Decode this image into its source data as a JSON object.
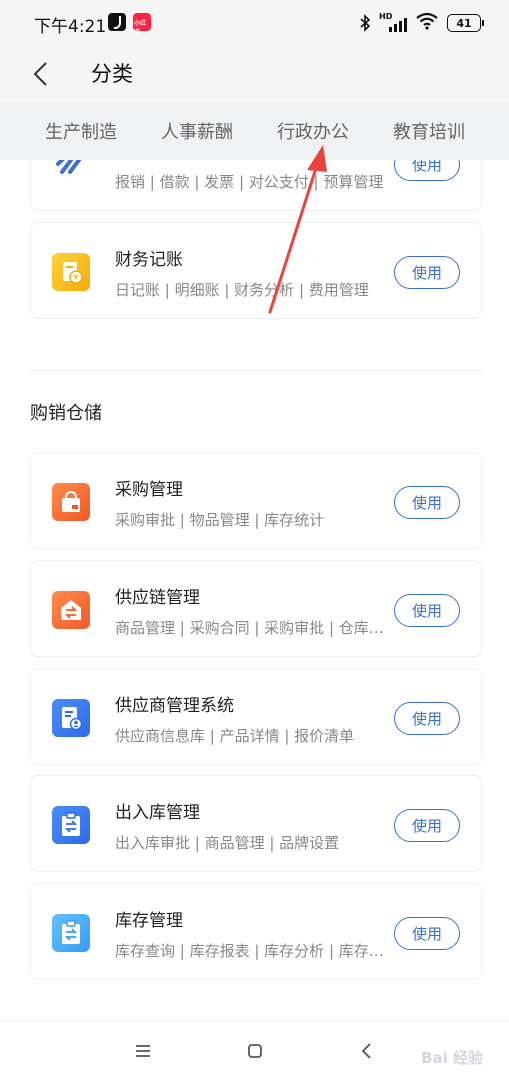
{
  "status_bar": {
    "time": "下午4:21",
    "battery": "41",
    "network_badge": "HD",
    "app_badge": "小红书"
  },
  "nav": {
    "title": "分类",
    "back_icon": "chevron-left-icon"
  },
  "tabs": [
    {
      "label": "生产制造"
    },
    {
      "label": "人事薪酬"
    },
    {
      "label": "行政办公"
    },
    {
      "label": "教育培训"
    }
  ],
  "top_cards": [
    {
      "name": "",
      "tags": "报销 | 借款 | 发票 | 对公支付 | 预算管理",
      "button": "使用",
      "icon": "reimburse-icon"
    },
    {
      "name": "财务记账",
      "tags": "日记账 | 明细账 | 财务分析 | 费用管理",
      "button": "使用",
      "icon": "ledger-icon"
    }
  ],
  "section": {
    "title": "购销仓储",
    "cards": [
      {
        "name": "采购管理",
        "tags": "采购审批 | 物品管理 | 库存统计",
        "button": "使用",
        "icon": "purchase-bag-icon"
      },
      {
        "name": "供应链管理",
        "tags": "商品管理 | 采购合同 | 采购审批 | 仓库管理",
        "button": "使用",
        "icon": "supply-chain-icon"
      },
      {
        "name": "供应商管理系统",
        "tags": "供应商信息库 | 产品详情 | 报价清单",
        "button": "使用",
        "icon": "supplier-icon"
      },
      {
        "name": "出入库管理",
        "tags": "出入库审批 | 商品管理 | 品牌设置",
        "button": "使用",
        "icon": "inout-clipboard-icon"
      },
      {
        "name": "库存管理",
        "tags": "库存查询 | 库存报表 | 库存分析 | 库存预警",
        "button": "使用",
        "icon": "inventory-clipboard-icon"
      }
    ]
  },
  "bottom_nav": {
    "menu_icon": "menu-icon",
    "home_icon": "home-square-icon",
    "back_icon": "back-triangle-icon"
  },
  "colors": {
    "accent": "#3870d4",
    "annotation_arrow": "#e8453c"
  }
}
